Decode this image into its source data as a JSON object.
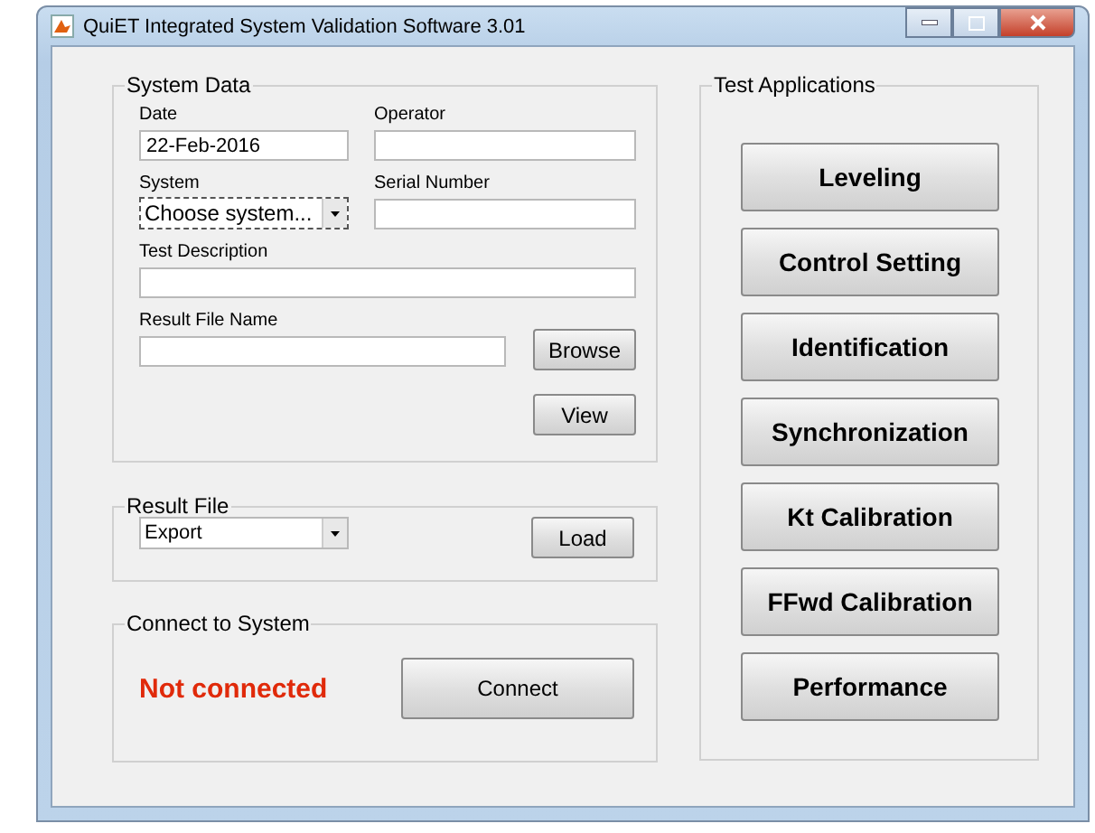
{
  "window": {
    "title": "QuiET Integrated System Validation Software 3.01"
  },
  "system_data": {
    "title": "System Data",
    "date": {
      "label": "Date",
      "value": "22-Feb-2016"
    },
    "operator": {
      "label": "Operator"
    },
    "system": {
      "label": "System",
      "value": "Choose system..."
    },
    "serial_number": {
      "label": "Serial Number"
    },
    "test_description": {
      "label": "Test Description"
    },
    "result_file_name": {
      "label": "Result File Name"
    },
    "buttons": [
      "Browse",
      "View"
    ]
  },
  "result_file": {
    "title": "Result File",
    "value": "Export",
    "button": "Load"
  },
  "connect": {
    "title": "Connect to System",
    "status": "Not connected",
    "button": "Connect"
  },
  "test_applications": {
    "title": "Test Applications",
    "buttons": [
      "Leveling",
      "Control Setting",
      "Identification",
      "Synchronization",
      "Kt Calibration",
      "FFwd Calibration",
      "Performance"
    ]
  }
}
